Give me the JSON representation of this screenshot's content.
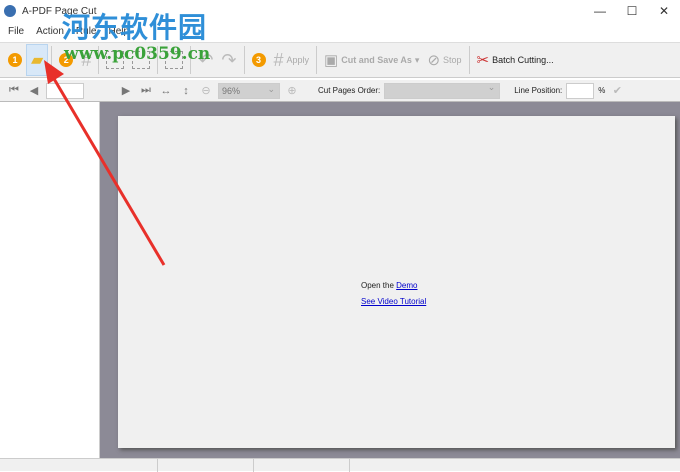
{
  "window": {
    "title": "A-PDF Page Cut",
    "minimize": "—",
    "maximize": "☐",
    "close": "✕"
  },
  "menu": [
    "File",
    "Action",
    "Rule",
    "Help"
  ],
  "toolbar": {
    "step1": "1",
    "step2": "2",
    "step3": "3",
    "apply": "Apply",
    "cut_save": "Cut and Save As",
    "stop": "Stop",
    "batch": "Batch Cutting..."
  },
  "toolbar2": {
    "zoom": "96%",
    "cut_order_label": "Cut Pages Order:",
    "line_position_label": "Line Position:",
    "percent": "%"
  },
  "page": {
    "open_text": "Open the",
    "demo_link": "Demo",
    "video_link": "See Video Tutorial"
  },
  "watermark": {
    "site_name": "河东软件园",
    "url": "www.pc0359.cn"
  },
  "colors": {
    "accent": "#f39a00",
    "link": "#0000cc",
    "annotation_arrow": "#e8302a"
  }
}
